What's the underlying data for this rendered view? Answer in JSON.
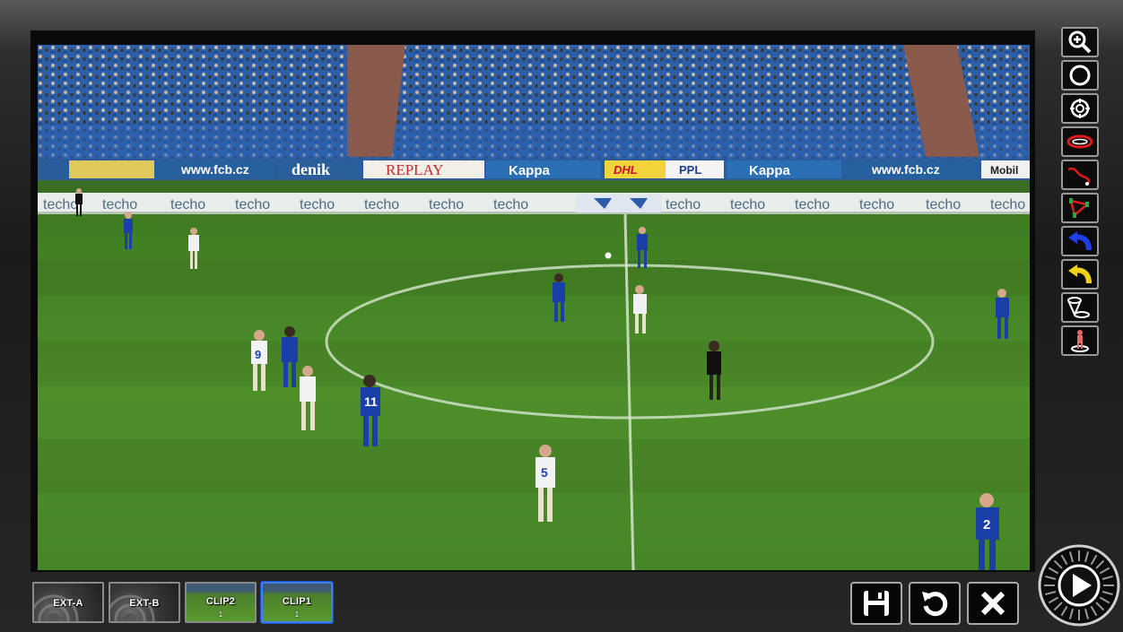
{
  "sources": [
    {
      "label": "EXT-A",
      "sub": ""
    },
    {
      "label": "EXT-B",
      "sub": ""
    },
    {
      "label": "CLIP2",
      "sub": "1"
    },
    {
      "label": "CLIP1",
      "sub": "1"
    }
  ],
  "video": {
    "ads_top": [
      "www.fcb.cz",
      "denik",
      "REPLAY",
      "Kappa",
      "DHL",
      "PPL",
      "Kappa",
      "www.fcb.cz",
      "Mobil"
    ],
    "ads_bottom": [
      "techo",
      "techo",
      "techo",
      "techo",
      "techo",
      "techo",
      "techo",
      "techo",
      "techo",
      "techo",
      "techo",
      "techo",
      "techo",
      "techo",
      "techo"
    ],
    "shirt_numbers": [
      "9",
      "11",
      "5",
      "2"
    ]
  },
  "tools": [
    "zoom-icon",
    "circle-icon",
    "spotlight-icon",
    "ellipse-highlight-icon",
    "path-line-icon",
    "player-connect-icon",
    "blue-curve-arrow-icon",
    "yellow-curve-arrow-icon",
    "spotlight-cone-icon",
    "player-marker-icon"
  ],
  "colors": {
    "selected_border": "#3b7df3",
    "pitch": "#4e8f2a",
    "blue_team": "#1a3fa8",
    "white_team": "#f2f2f2"
  }
}
